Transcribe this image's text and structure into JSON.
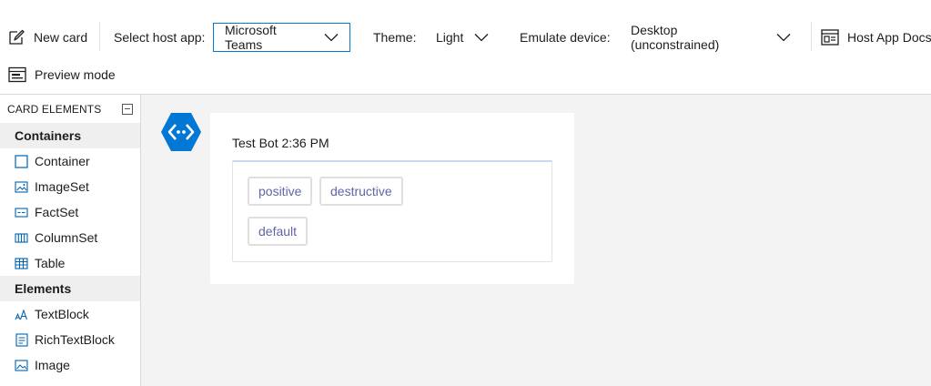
{
  "toolbar": {
    "new_card_label": "New card",
    "host_app_label": "Select host app:",
    "host_app_value": "Microsoft Teams",
    "theme_label": "Theme:",
    "theme_value": "Light",
    "device_label": "Emulate device:",
    "device_value": "Desktop (unconstrained)",
    "docs_label": "Host App Docs",
    "preview_label": "Preview mode",
    "accent_color": "#0078d4"
  },
  "sidebar": {
    "header": "CARD ELEMENTS",
    "categories": [
      {
        "label": "Containers",
        "items": [
          {
            "label": "Container",
            "icon": "container-icon"
          },
          {
            "label": "ImageSet",
            "icon": "imageset-icon"
          },
          {
            "label": "FactSet",
            "icon": "factset-icon"
          },
          {
            "label": "ColumnSet",
            "icon": "columnset-icon"
          },
          {
            "label": "Table",
            "icon": "table-icon"
          }
        ]
      },
      {
        "label": "Elements",
        "items": [
          {
            "label": "TextBlock",
            "icon": "textblock-icon"
          },
          {
            "label": "RichTextBlock",
            "icon": "richtextblock-icon"
          },
          {
            "label": "Image",
            "icon": "image-icon"
          }
        ]
      }
    ]
  },
  "preview": {
    "header": "Test Bot 2:36 PM",
    "actions": [
      "positive",
      "destructive",
      "default"
    ],
    "action_text_color": "#6264a7",
    "avatar_color": "#0078d4"
  }
}
